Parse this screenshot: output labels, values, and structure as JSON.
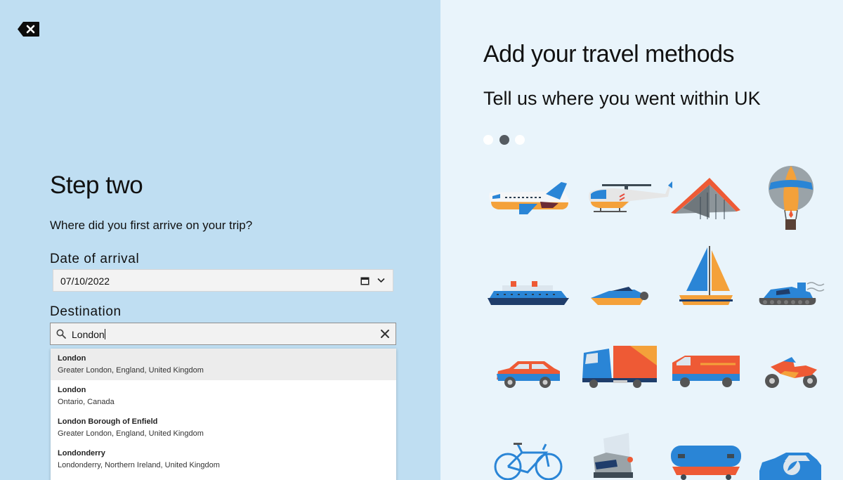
{
  "left": {
    "back_icon": "backspace-close-icon",
    "title": "Step two",
    "question": "Where did you first arrive on your trip?",
    "date_label": "Date of arrival",
    "date_value": "07/10/2022",
    "date_icons": [
      "calendar-icon",
      "chevron-down-icon"
    ],
    "destination_label": "Destination",
    "destination_value": "London",
    "destination_icons": [
      "search-icon",
      "clear-icon"
    ],
    "suggestions": [
      {
        "name": "London",
        "detail": "Greater London, England, United Kingdom"
      },
      {
        "name": "London",
        "detail": "Ontario, Canada"
      },
      {
        "name": "London Borough of Enfield",
        "detail": "Greater London, England, United Kingdom"
      },
      {
        "name": "Londonderry",
        "detail": "Londonderry, Northern Ireland, United Kingdom"
      }
    ]
  },
  "right": {
    "title": "Add your travel methods",
    "subtitle": "Tell us where you went within UK",
    "carousel": {
      "total": 3,
      "active": 2
    },
    "illustrations": [
      "airplane-icon",
      "helicopter-icon",
      "hang-glider-icon",
      "hot-air-balloon-icon",
      "cruise-ship-icon",
      "speedboat-icon",
      "sailboat-icon",
      "hovercraft-icon",
      "car-icon",
      "lorry-icon",
      "van-icon",
      "motorcycle-icon",
      "bicycle-icon",
      "rollerblade-icon",
      "skateboard-icon",
      "electric-car-icon"
    ]
  },
  "colors": {
    "left_panel_bg": "#bfdef2",
    "right_panel_bg": "#e9f4fb",
    "accent_orange": "#f4a13a",
    "accent_blue": "#2a85d6",
    "accent_red": "#ee5a35"
  }
}
